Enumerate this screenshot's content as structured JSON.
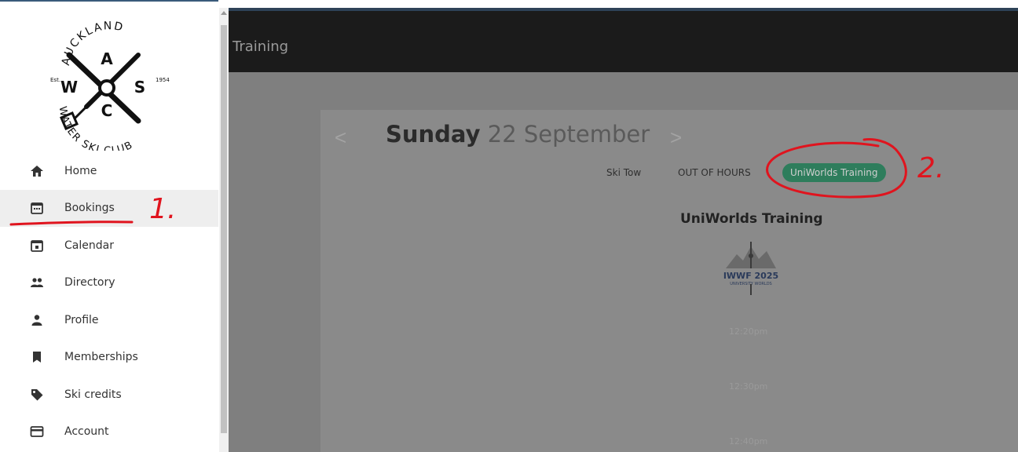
{
  "sidebar": {
    "logo": {
      "top_text": "AUCKLAND",
      "bottom_text": "WATER SKI CLUB",
      "letter_a": "A",
      "letter_w": "W",
      "letter_s": "S",
      "letter_c": "C",
      "est": "Est.",
      "year": "1954"
    },
    "items": [
      {
        "label": "Home",
        "icon": "home-icon"
      },
      {
        "label": "Bookings",
        "icon": "calendar-dots-icon"
      },
      {
        "label": "Calendar",
        "icon": "calendar-today-icon"
      },
      {
        "label": "Directory",
        "icon": "people-icon"
      },
      {
        "label": "Profile",
        "icon": "person-icon"
      },
      {
        "label": "Memberships",
        "icon": "bookmark-icon"
      },
      {
        "label": "Ski credits",
        "icon": "tag-icon"
      },
      {
        "label": "Account",
        "icon": "credit-card-icon"
      }
    ],
    "active_item": "Bookings"
  },
  "header": {
    "title": "Training"
  },
  "booking": {
    "prev_label": "<",
    "next_label": ">",
    "day": "Sunday",
    "date": "22 September",
    "tabs": [
      {
        "label": "Ski Tow"
      },
      {
        "label": "OUT OF HOURS"
      },
      {
        "label": "UniWorlds Training"
      }
    ],
    "session_title": "UniWorlds Training",
    "session_logo": {
      "line1": "IWWF 2025",
      "line2": "UNIVERSITY WORLDS"
    },
    "time_slots": [
      "12:20pm",
      "12:30pm",
      "12:40pm"
    ]
  },
  "annotations": {
    "marker_1": "1.",
    "marker_2": "2."
  },
  "colors": {
    "accent_green": "#2e7d5c",
    "annotation_red": "#e0141e",
    "appbar": "#1b1b1b",
    "overlay": "#7f7f7f"
  }
}
